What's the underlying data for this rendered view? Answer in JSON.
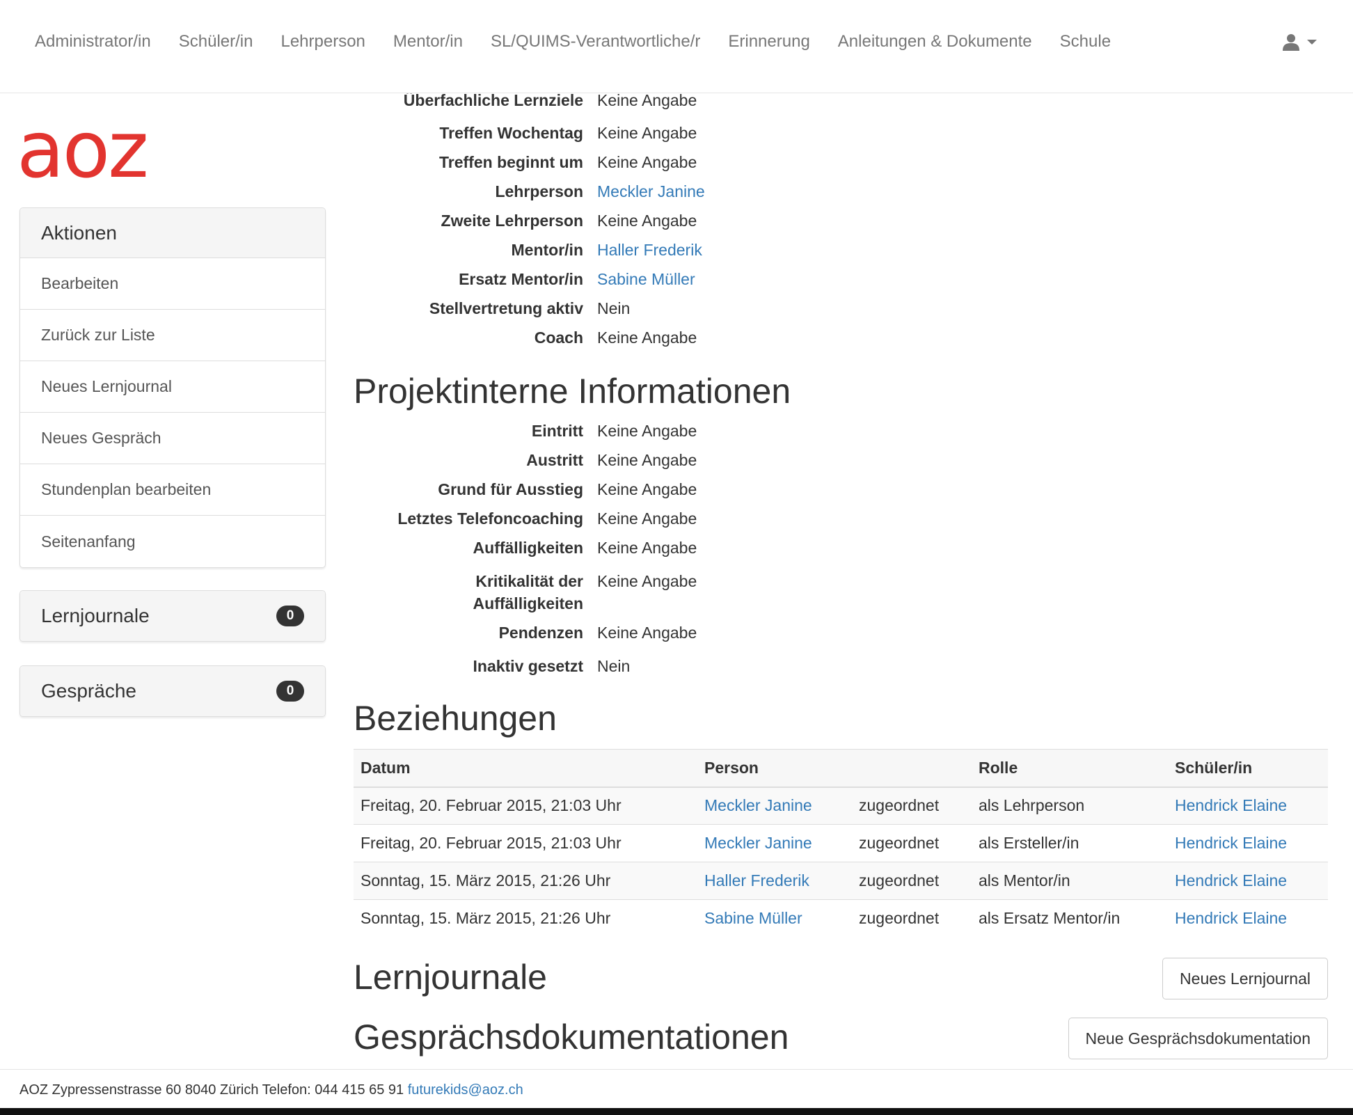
{
  "nav": {
    "items": [
      "Administrator/in",
      "Schüler/in",
      "Lehrperson",
      "Mentor/in",
      "SL/QUIMS-Verantwortliche/r",
      "Erinnerung",
      "Anleitungen & Dokumente",
      "Schule"
    ],
    "user_icon": "user-icon"
  },
  "logo": {
    "text": "aoz",
    "color": "#e2342f"
  },
  "sidebar": {
    "actions": {
      "title": "Aktionen",
      "items": [
        "Bearbeiten",
        "Zurück zur Liste",
        "Neues Lernjournal",
        "Neues Gespräch",
        "Stundenplan bearbeiten",
        "Seitenanfang"
      ]
    },
    "lernjournale": {
      "title": "Lernjournale",
      "count": "0"
    },
    "gespraeche": {
      "title": "Gespräche",
      "count": "0"
    }
  },
  "details": [
    {
      "label": "Überfachliche Lernziele",
      "value": "Keine Angabe",
      "link": false
    },
    {
      "label": "Treffen Wochentag",
      "value": "Keine Angabe",
      "link": false
    },
    {
      "label": "Treffen beginnt um",
      "value": "Keine Angabe",
      "link": false
    },
    {
      "label": "Lehrperson",
      "value": "Meckler Janine",
      "link": true
    },
    {
      "label": "Zweite Lehrperson",
      "value": "Keine Angabe",
      "link": false
    },
    {
      "label": "Mentor/in",
      "value": "Haller Frederik",
      "link": true
    },
    {
      "label": "Ersatz Mentor/in",
      "value": "Sabine Müller",
      "link": true
    },
    {
      "label": "Stellvertretung aktiv",
      "value": "Nein",
      "link": false
    },
    {
      "label": "Coach",
      "value": "Keine Angabe",
      "link": false
    }
  ],
  "projekt": {
    "heading": "Projektinterne Informationen",
    "rows": [
      {
        "label": "Eintritt",
        "value": "Keine Angabe"
      },
      {
        "label": "Austritt",
        "value": "Keine Angabe"
      },
      {
        "label": "Grund für Ausstieg",
        "value": "Keine Angabe"
      },
      {
        "label": "Letztes Telefoncoaching",
        "value": "Keine Angabe"
      },
      {
        "label": "Auffälligkeiten",
        "value": "Keine Angabe"
      },
      {
        "label": "Kritikalität der Auffälligkeiten",
        "value": "Keine Angabe"
      },
      {
        "label": "Pendenzen",
        "value": "Keine Angabe"
      },
      {
        "label": "Inaktiv gesetzt",
        "value": "Nein"
      }
    ]
  },
  "beziehungen": {
    "heading": "Beziehungen",
    "columns": [
      "Datum",
      "Person",
      "",
      "Rolle",
      "Schüler/in"
    ],
    "rows": [
      [
        "Freitag, 20. Februar 2015, 21:03 Uhr",
        "Meckler Janine",
        "zugeordnet",
        "als Lehrperson",
        "Hendrick Elaine"
      ],
      [
        "Freitag, 20. Februar 2015, 21:03 Uhr",
        "Meckler Janine",
        "zugeordnet",
        "als Ersteller/in",
        "Hendrick Elaine"
      ],
      [
        "Sonntag, 15. März 2015, 21:26 Uhr",
        "Haller Frederik",
        "zugeordnet",
        "als Mentor/in",
        "Hendrick Elaine"
      ],
      [
        "Sonntag, 15. März 2015, 21:26 Uhr",
        "Sabine Müller",
        "zugeordnet",
        "als Ersatz Mentor/in",
        "Hendrick Elaine"
      ]
    ]
  },
  "lernjournale_section": {
    "heading": "Lernjournale",
    "button": "Neues Lernjournal"
  },
  "gespraech_section": {
    "heading": "Gesprächsdokumentationen",
    "button": "Neue Gesprächsdokumentation"
  },
  "footer": {
    "address": "AOZ Zypressenstrasse 60 8040 Zürich Telefon: 044 415 65 91",
    "email": "futurekids@aoz.ch"
  },
  "colors": {
    "link": "#337ab7",
    "brand": "#e2342f",
    "text": "#333333",
    "nav_text": "#777777"
  }
}
